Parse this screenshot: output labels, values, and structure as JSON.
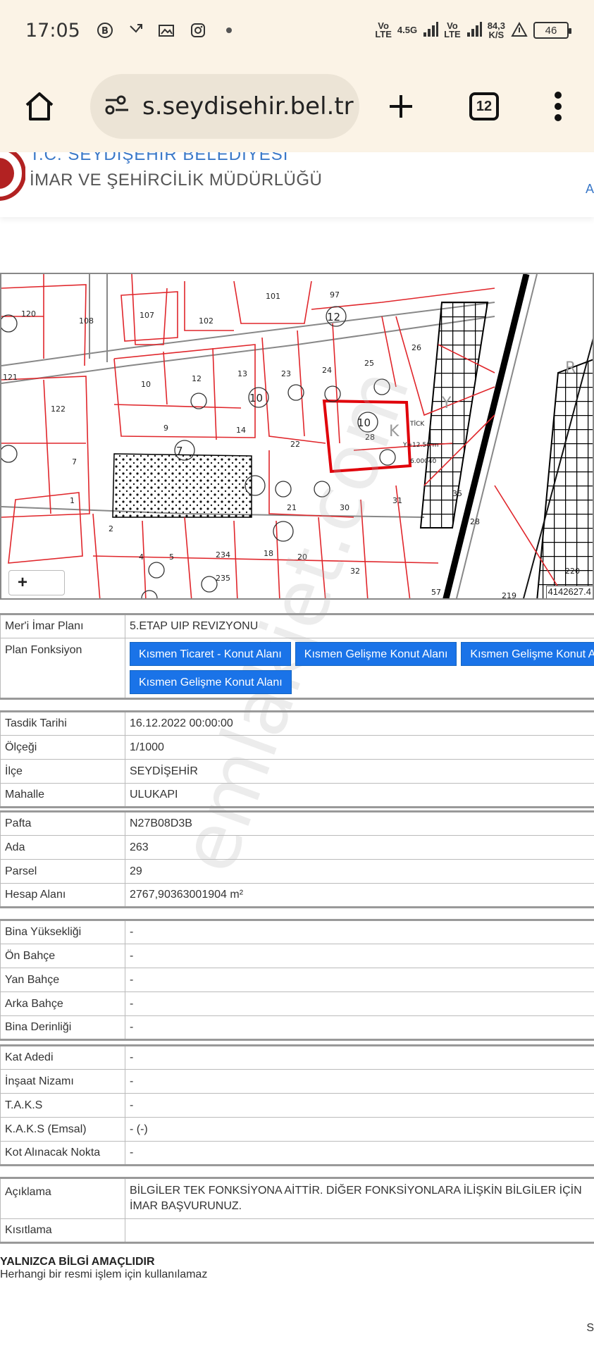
{
  "status_bar": {
    "time": "17:05",
    "net1_top": "Vo",
    "net1_bot": "LTE",
    "net_4g": "4.5G",
    "net2_top": "Vo",
    "net2_bot": "LTE",
    "speed_top": "84,3",
    "speed_bot": "K/S",
    "battery": "46"
  },
  "browser": {
    "url": "s.seydisehir.bel.tr",
    "tab_count": "12"
  },
  "site_header": {
    "title": "T.C. SEYDİŞEHİR BELEDİYESİ",
    "subtitle": "İMAR VE ŞEHİRCİLİK MÜDÜRLÜĞÜ",
    "link": "A"
  },
  "map": {
    "zoom_plus": "+",
    "coordinate": "4142627.4"
  },
  "info": {
    "group1": [
      {
        "label": "Mer'i İmar Planı",
        "value": "5.ETAP UIP REVIZYONU"
      }
    ],
    "plan_function_label": "Plan Fonksiyon",
    "plan_functions": [
      "Kısmen Ticaret - Konut Alanı",
      "Kısmen Gelişme Konut Alanı",
      "Kısmen Gelişme Konut Alanı",
      "Kısmen Gelişme Konut Alanı"
    ],
    "group2": [
      {
        "label": "Tasdik Tarihi",
        "value": "16.12.2022 00:00:00"
      },
      {
        "label": "Ölçeği",
        "value": "1/1000"
      },
      {
        "label": "İlçe",
        "value": "SEYDİŞEHİR"
      },
      {
        "label": "Mahalle",
        "value": "ULUKAPI"
      }
    ],
    "group3": [
      {
        "label": "Pafta",
        "value": "N27B08D3B"
      },
      {
        "label": "Ada",
        "value": "263"
      },
      {
        "label": "Parsel",
        "value": "29"
      },
      {
        "label": "Hesap Alanı",
        "value": "2767,90363001904 m²"
      }
    ],
    "group4": [
      {
        "label": "Bina Yüksekliği",
        "value": "-"
      },
      {
        "label": "Ön Bahçe",
        "value": "-"
      },
      {
        "label": "Yan Bahçe",
        "value": "-"
      },
      {
        "label": "Arka Bahçe",
        "value": "-"
      },
      {
        "label": "Bina Derinliği",
        "value": "-"
      }
    ],
    "group5": [
      {
        "label": "Kat Adedi",
        "value": "-"
      },
      {
        "label": "İnşaat Nizamı",
        "value": "-"
      },
      {
        "label": "T.A.K.S",
        "value": "-"
      },
      {
        "label": "K.A.K.S (Emsal)",
        "value": "- (-)"
      },
      {
        "label": "Kot Alınacak Nokta",
        "value": "-"
      }
    ],
    "group6": [
      {
        "label": "Açıklama",
        "value": "BİLGİLER TEK FONKSİYONA AİTTİR. DİĞER FONKSİYONLARA İLİŞKİN BİLGİLER İÇİN İMAR BAŞVURUNUZ."
      },
      {
        "label": "Kısıtlama",
        "value": ""
      }
    ]
  },
  "footer": {
    "title": "YALNIZCA BİLGİ AMAÇLIDIR",
    "text": "Herhangi bir resmi işlem için kullanılamaz",
    "corner": "S"
  },
  "watermark": "emlakjet.com"
}
